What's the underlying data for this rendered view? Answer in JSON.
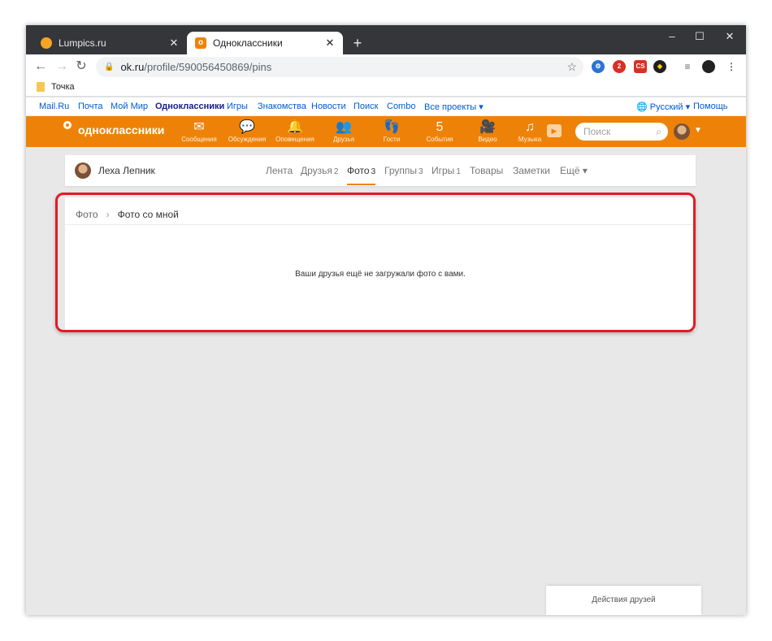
{
  "browser": {
    "tabs": [
      {
        "title": "Lumpics.ru",
        "close": "✕"
      },
      {
        "title": "Одноклассники",
        "close": "✕"
      }
    ],
    "new_tab": "+",
    "window_controls": {
      "minimize": "–",
      "maximize": "☐",
      "close": "✕"
    },
    "url_host": "ok.ru",
    "url_path": "/profile/590056450869/pins",
    "bookmark": "Точка",
    "ext_badge": "2",
    "ext_cs": "CS"
  },
  "portal_links": [
    "Mail.Ru",
    "Почта",
    "Мой Мир",
    "Одноклассники",
    "Игры",
    "Знакомства",
    "Новости",
    "Поиск",
    "Combo",
    "Все проекты ▾"
  ],
  "portal_right": {
    "lang": "Русский ▾",
    "help": "Помощь"
  },
  "ok_header": {
    "logo": "одноклассники",
    "nav": [
      {
        "icon": "✉",
        "label": "Сообщения"
      },
      {
        "icon": "💬",
        "label": "Обсуждения"
      },
      {
        "icon": "🔔",
        "label": "Оповещения"
      },
      {
        "icon": "👥",
        "label": "Друзья"
      },
      {
        "icon": "👣",
        "label": "Гости"
      },
      {
        "icon": "5",
        "label": "События"
      },
      {
        "icon": "🎥",
        "label": "Видео"
      },
      {
        "icon": "♫",
        "label": "Музыка"
      }
    ],
    "search_placeholder": "Поиск"
  },
  "profile": {
    "name": "Леха Лепник",
    "tabs": [
      {
        "label": "Лента",
        "count": ""
      },
      {
        "label": "Друзья",
        "count": "2"
      },
      {
        "label": "Фото",
        "count": "3"
      },
      {
        "label": "Группы",
        "count": "3"
      },
      {
        "label": "Игры",
        "count": "1"
      },
      {
        "label": "Товары",
        "count": ""
      },
      {
        "label": "Заметки",
        "count": ""
      },
      {
        "label": "Ещё ▾",
        "count": ""
      }
    ]
  },
  "photos": {
    "breadcrumb_root": "Фото",
    "breadcrumb_current": "Фото со мной",
    "empty_message": "Ваши друзья ещё не загружали фото с вами."
  },
  "friends_actions": "Действия друзей",
  "colors": {
    "ok_orange": "#ee8208",
    "highlight_red": "#e31b23"
  }
}
